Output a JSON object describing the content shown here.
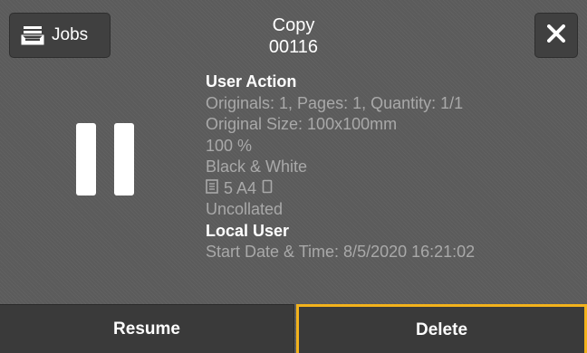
{
  "header": {
    "title": "Copy",
    "job_number": "00116"
  },
  "jobs_button": {
    "label": "Jobs",
    "icon": "tray-stack-icon"
  },
  "close_button": {
    "icon": "close-icon"
  },
  "status_icon": "pause-icon",
  "details": {
    "status": "User Action",
    "originals": "Originals: 1, Pages: 1, Quantity: 1/1",
    "original_size": "Original Size: 100x100mm",
    "zoom": "100 %",
    "color_mode": "Black & White",
    "paper": "5 A4",
    "collation": "Uncollated",
    "owner": "Local User",
    "start_datetime": "Start Date & Time: 8/5/2020 16:21:02"
  },
  "actions": {
    "resume_label": "Resume",
    "delete_label": "Delete"
  },
  "colors": {
    "background": "#5b5b5b",
    "button_bg": "#404040",
    "highlight": "#f2b21c",
    "dim_text": "#a9a9a9"
  }
}
